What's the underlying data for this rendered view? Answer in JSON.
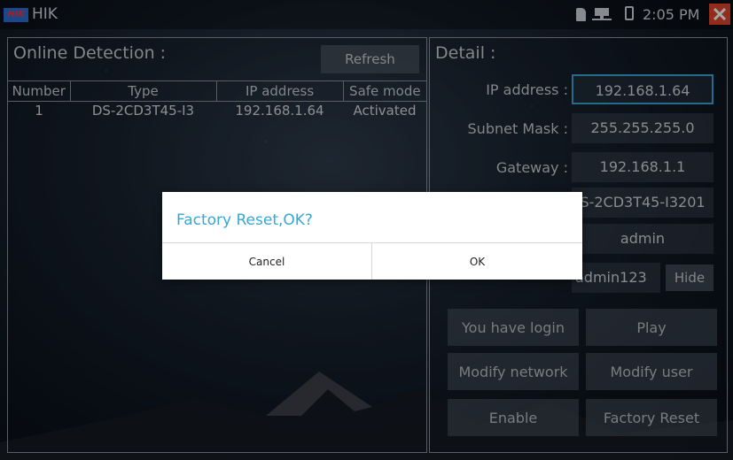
{
  "statusbar": {
    "app_name": "HIK",
    "logo_text": "HIK",
    "time": "2:05 PM"
  },
  "online": {
    "title": "Online Detection :",
    "refresh_label": "Refresh",
    "columns": [
      "Number",
      "Type",
      "IP address",
      "Safe mode"
    ],
    "rows": [
      [
        "1",
        "DS-2CD3T45-I3",
        "192.168.1.64",
        "Activated"
      ]
    ]
  },
  "detail": {
    "title": "Detail :",
    "fields": [
      {
        "label": "IP address :",
        "value": "192.168.1.64"
      },
      {
        "label": "Subnet Mask :",
        "value": "255.255.255.0"
      },
      {
        "label": "Gateway :",
        "value": "192.168.1.1"
      },
      {
        "label": "",
        "value": "S-2CD3T45-I3201"
      },
      {
        "label": "",
        "value": "admin"
      },
      {
        "label": "",
        "value": "admin123"
      }
    ],
    "hide_label": "Hide",
    "buttons": {
      "login": "You have login",
      "play": "Play",
      "modify_network": "Modify network",
      "modify_user": "Modify user",
      "enable": "Enable",
      "factory_reset": "Factory Reset"
    }
  },
  "dialog": {
    "title": "Factory Reset,OK?",
    "cancel": "Cancel",
    "ok": "OK"
  },
  "colors": {
    "accent": "#35a8d6",
    "close": "#e0442d",
    "logo_bg": "#2a6fd6"
  }
}
